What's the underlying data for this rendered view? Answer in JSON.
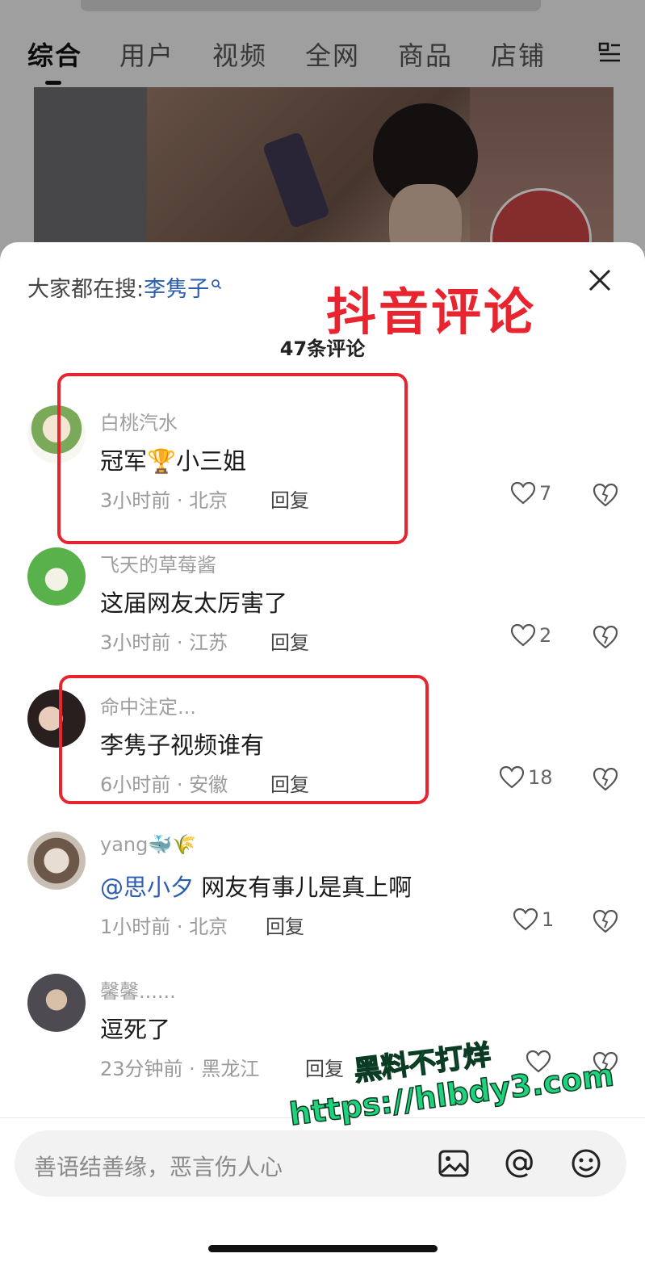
{
  "background": {
    "tabs": [
      "综合",
      "用户",
      "视频",
      "全网",
      "商品",
      "店铺"
    ],
    "active_tab": "综合"
  },
  "sheet": {
    "hot_search_label": "大家都在搜:",
    "hot_search_keyword": "李隽子",
    "overlay_title": "抖音评论",
    "comment_count": "47条评论"
  },
  "comments": [
    {
      "username": "白桃汽水",
      "text": "冠军🏆小三姐",
      "meta": "3小时前 · 北京",
      "reply": "回复",
      "likes": "7"
    },
    {
      "username": "飞天的草莓酱",
      "text": "这届网友太厉害了",
      "meta": "3小时前 · 江苏",
      "reply": "回复",
      "likes": "2"
    },
    {
      "username": "命中注定...",
      "text": "李隽子视频谁有",
      "meta": "6小时前 · 安徽",
      "reply": "回复",
      "likes": "18"
    },
    {
      "username": "yang🐳🌾",
      "mention": "@思小夕",
      "text": " 网友有事儿是真上啊",
      "meta": "1小时前 · 北京",
      "reply": "回复",
      "likes": "1"
    },
    {
      "username": "馨馨......",
      "text": "逗死了",
      "meta": "23分钟前 · 黑龙江",
      "reply": "回复",
      "likes": ""
    }
  ],
  "input": {
    "placeholder": "善语结善缘，恶言伤人心"
  },
  "watermark": {
    "line1": "黑料不打烊",
    "line2": "https://hlbdy3.com"
  },
  "colors": {
    "accent_red": "#e8242f",
    "link_blue": "#2b5db0",
    "watermark_green": "#1ed37d"
  }
}
